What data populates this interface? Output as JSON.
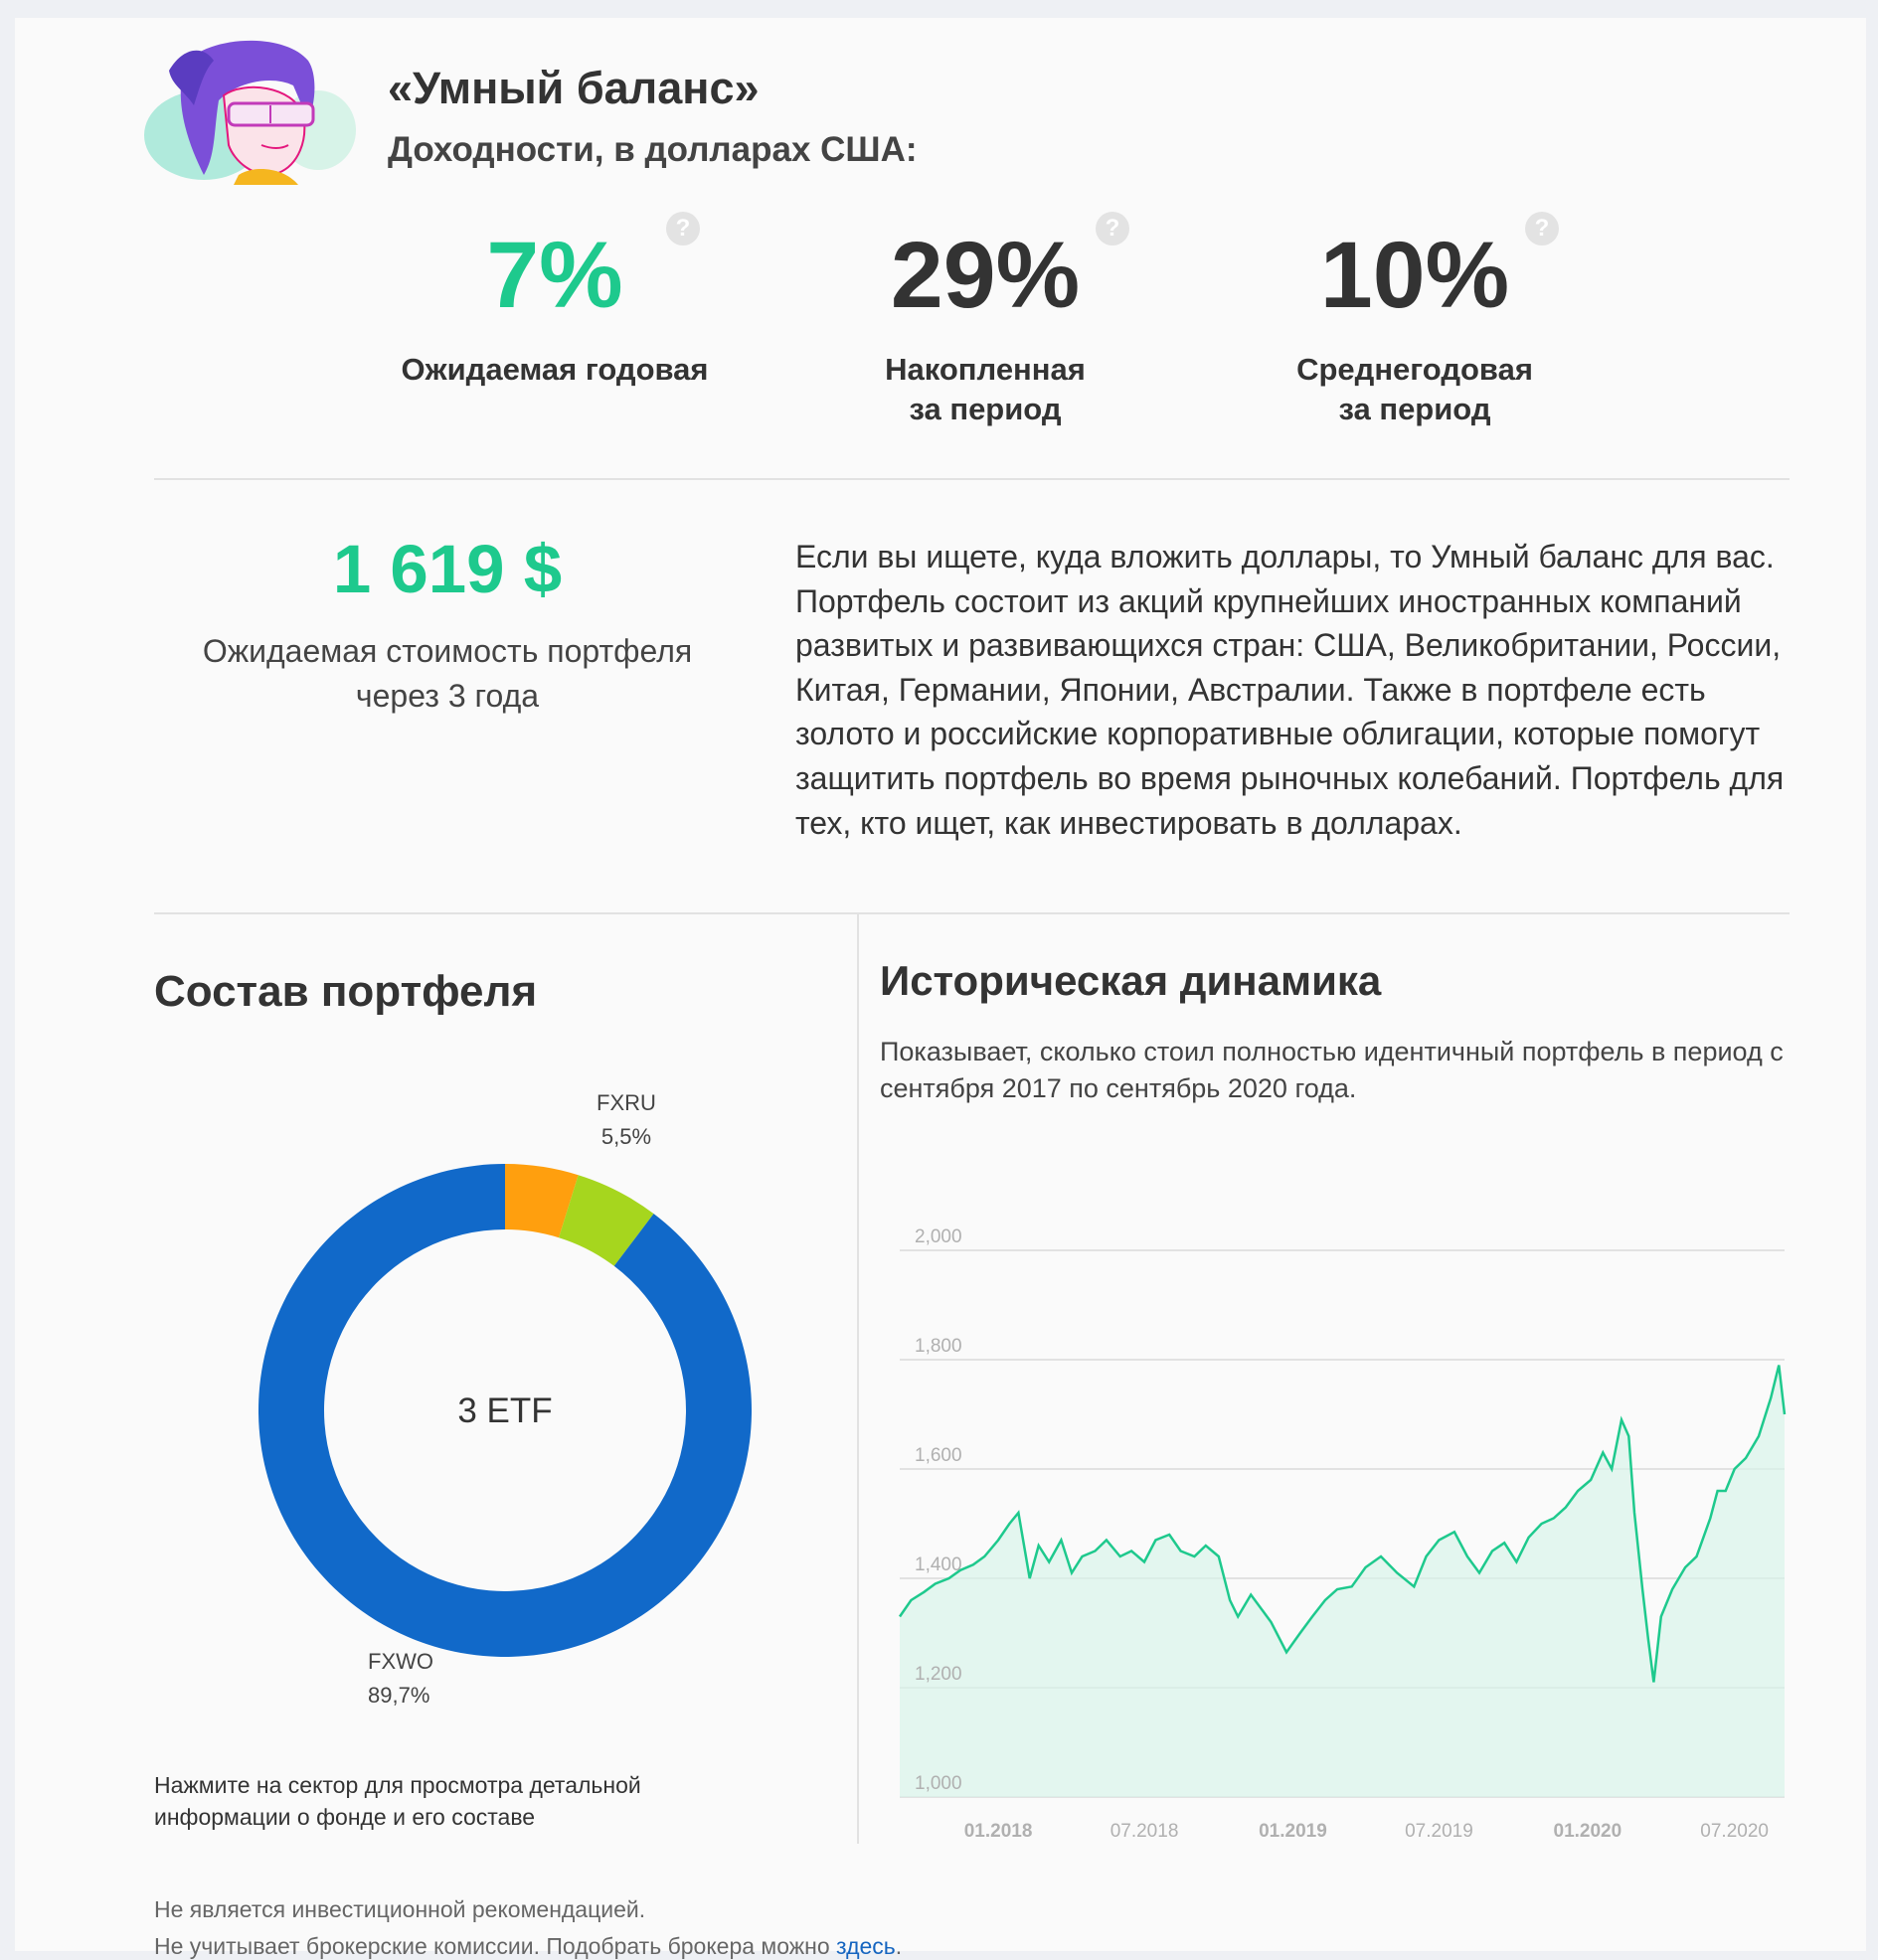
{
  "header": {
    "title": "«Умный баланс»",
    "subtitle": "Доходности, в долларах США:"
  },
  "metrics": [
    {
      "value": "7%",
      "label": "Ожидаемая годовая",
      "color": "#1ec98d",
      "help": "?"
    },
    {
      "value": "29%",
      "label": "Накопленная\nза период",
      "color": "#333333",
      "help": "?"
    },
    {
      "value": "10%",
      "label": "Среднегодовая\nза период",
      "color": "#333333",
      "help": "?"
    }
  ],
  "expected": {
    "value": "1 619 $",
    "label": "Ожидаемая стоимость портфеля\nчерез 3 года"
  },
  "description": "Если вы ищете, куда вложить доллары, то Умный баланс для вас. Портфель состоит из акций крупнейших иностранных компаний развитых и развивающихся стран: США, Великобритании, России, Китая, Германии, Японии, Австралии. Также в портфеле есть золото и российские корпоративные облигации, которые помогут защитить портфель во время рыночных колебаний. Портфель для тех, кто ищет, как инвестировать в долларах.",
  "composition": {
    "title": "Состав портфеля",
    "center_label": "3 ETF",
    "hint": "Нажмите на сектор для просмотра детальной информации о фонде и его составе"
  },
  "history": {
    "title": "Историческая динамика",
    "subtitle": "Показывает, сколько стоил полностью идентичный портфель в период с сентября 2017 по сентябрь 2020 года."
  },
  "footer": {
    "line1": "Не является инвестиционной рекомендацией.",
    "line2": "Не учитывает брокерские комиссии. Подобрать брокера можно ",
    "link": "здесь",
    "line2_end": "."
  },
  "chart_data": [
    {
      "type": "pie",
      "variant": "donut",
      "slices": [
        {
          "label": "FXWO",
          "value": 89.7,
          "value_label": "89,7%",
          "color": "#1169c9",
          "labeled": true
        },
        {
          "label": "FXRU",
          "value": 5.5,
          "value_label": "5,5%",
          "color": "#a6d61e",
          "labeled": true
        },
        {
          "label": "",
          "value": 4.8,
          "value_label": "",
          "color": "#ff9f0e",
          "labeled": false
        }
      ]
    },
    {
      "type": "area",
      "line_color": "#1ec98d",
      "fill_color": "#d9f4ea",
      "ylim": [
        1000,
        2000
      ],
      "yticks": [
        1000,
        1200,
        1400,
        1600,
        1800,
        2000
      ],
      "ytick_labels": [
        "1,000",
        "1,200",
        "1,400",
        "1,600",
        "1,800",
        "2,000"
      ],
      "xlim": [
        "2017-09-01",
        "2020-09-01"
      ],
      "xticks": [
        "2018-01-01",
        "2018-07-01",
        "2019-01-01",
        "2019-07-01",
        "2020-01-01",
        "2020-07-01"
      ],
      "xtick_labels": [
        "01.2018",
        "07.2018",
        "01.2019",
        "07.2019",
        "01.2020",
        "07.2020"
      ],
      "grid": true,
      "series": [
        {
          "points": [
            [
              "2017-09-01",
              1330
            ],
            [
              "2017-09-15",
              1360
            ],
            [
              "2017-10-01",
              1375
            ],
            [
              "2017-10-15",
              1390
            ],
            [
              "2017-11-01",
              1400
            ],
            [
              "2017-11-15",
              1415
            ],
            [
              "2017-12-01",
              1425
            ],
            [
              "2017-12-15",
              1440
            ],
            [
              "2018-01-01",
              1470
            ],
            [
              "2018-01-15",
              1500
            ],
            [
              "2018-01-26",
              1520
            ],
            [
              "2018-02-09",
              1400
            ],
            [
              "2018-02-20",
              1460
            ],
            [
              "2018-03-05",
              1430
            ],
            [
              "2018-03-20",
              1470
            ],
            [
              "2018-04-02",
              1410
            ],
            [
              "2018-04-15",
              1440
            ],
            [
              "2018-05-01",
              1450
            ],
            [
              "2018-05-15",
              1470
            ],
            [
              "2018-06-01",
              1440
            ],
            [
              "2018-06-15",
              1450
            ],
            [
              "2018-07-01",
              1430
            ],
            [
              "2018-07-15",
              1470
            ],
            [
              "2018-08-01",
              1480
            ],
            [
              "2018-08-15",
              1450
            ],
            [
              "2018-09-01",
              1440
            ],
            [
              "2018-09-15",
              1460
            ],
            [
              "2018-10-01",
              1440
            ],
            [
              "2018-10-15",
              1360
            ],
            [
              "2018-10-25",
              1330
            ],
            [
              "2018-11-10",
              1370
            ],
            [
              "2018-11-25",
              1340
            ],
            [
              "2018-12-05",
              1320
            ],
            [
              "2018-12-24",
              1265
            ],
            [
              "2019-01-10",
              1300
            ],
            [
              "2019-01-25",
              1330
            ],
            [
              "2019-02-10",
              1360
            ],
            [
              "2019-02-25",
              1380
            ],
            [
              "2019-03-15",
              1385
            ],
            [
              "2019-04-01",
              1420
            ],
            [
              "2019-04-20",
              1440
            ],
            [
              "2019-05-10",
              1410
            ],
            [
              "2019-05-31",
              1385
            ],
            [
              "2019-06-15",
              1440
            ],
            [
              "2019-07-01",
              1470
            ],
            [
              "2019-07-20",
              1485
            ],
            [
              "2019-08-05",
              1440
            ],
            [
              "2019-08-20",
              1410
            ],
            [
              "2019-09-05",
              1450
            ],
            [
              "2019-09-20",
              1465
            ],
            [
              "2019-10-05",
              1430
            ],
            [
              "2019-10-20",
              1475
            ],
            [
              "2019-11-05",
              1500
            ],
            [
              "2019-11-20",
              1510
            ],
            [
              "2019-12-05",
              1530
            ],
            [
              "2019-12-20",
              1560
            ],
            [
              "2020-01-05",
              1580
            ],
            [
              "2020-01-20",
              1630
            ],
            [
              "2020-01-31",
              1600
            ],
            [
              "2020-02-12",
              1690
            ],
            [
              "2020-02-21",
              1660
            ],
            [
              "2020-02-28",
              1520
            ],
            [
              "2020-03-09",
              1380
            ],
            [
              "2020-03-16",
              1290
            ],
            [
              "2020-03-23",
              1210
            ],
            [
              "2020-04-01",
              1330
            ],
            [
              "2020-04-15",
              1380
            ],
            [
              "2020-05-01",
              1420
            ],
            [
              "2020-05-15",
              1440
            ],
            [
              "2020-06-01",
              1510
            ],
            [
              "2020-06-10",
              1560
            ],
            [
              "2020-06-20",
              1560
            ],
            [
              "2020-07-01",
              1600
            ],
            [
              "2020-07-15",
              1620
            ],
            [
              "2020-07-31",
              1660
            ],
            [
              "2020-08-15",
              1730
            ],
            [
              "2020-08-25",
              1790
            ],
            [
              "2020-09-01",
              1700
            ]
          ]
        }
      ]
    }
  ]
}
